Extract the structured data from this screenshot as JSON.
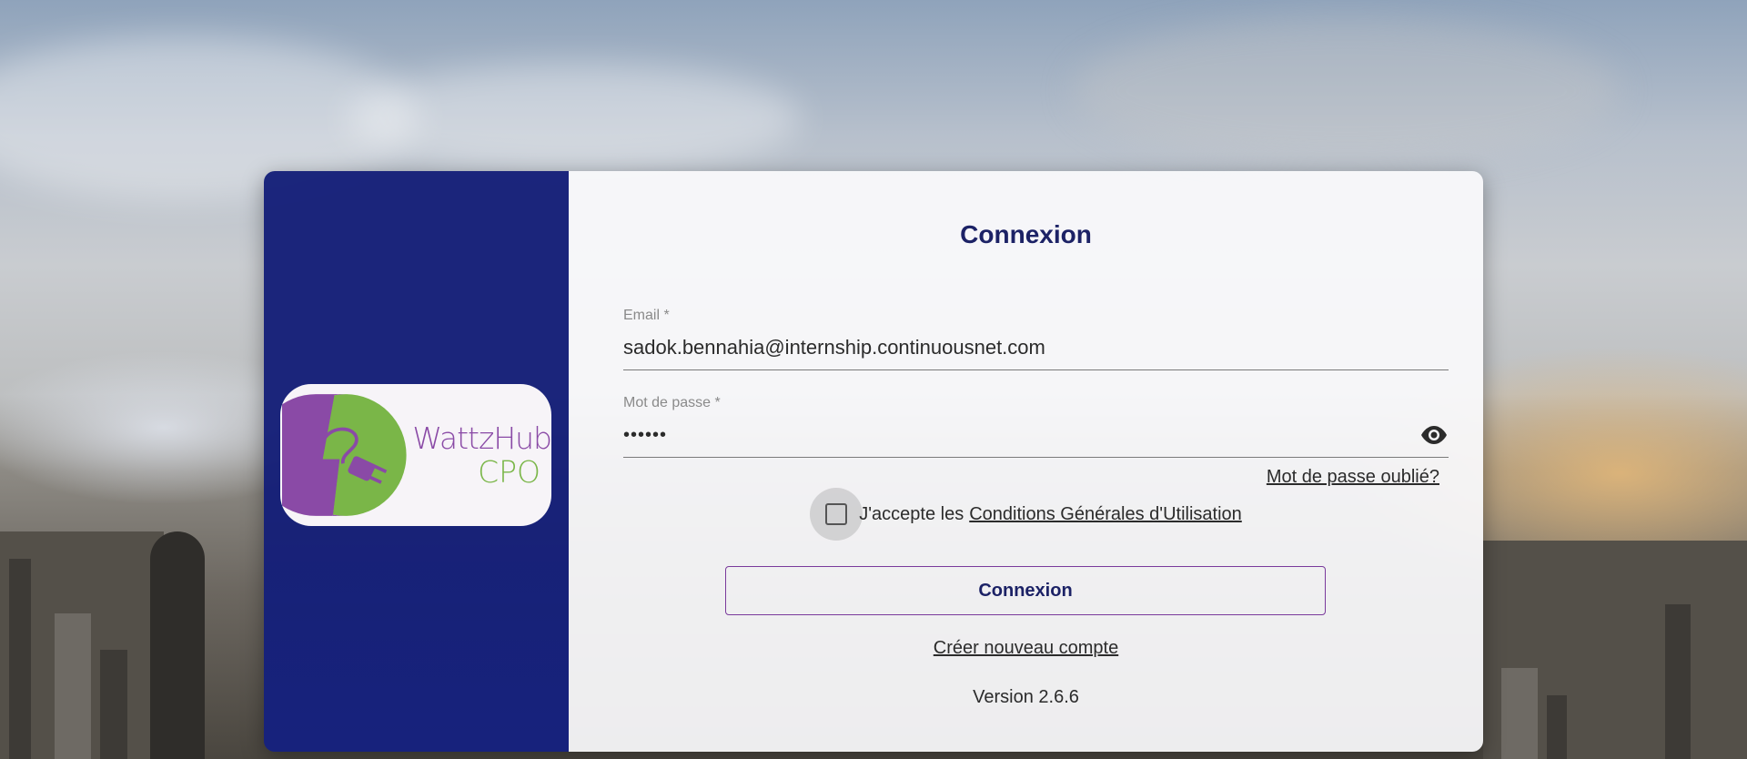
{
  "login": {
    "title": "Connexion",
    "email_label": "Email *",
    "email_value": "sadok.bennahia@internship.continuousnet.com",
    "password_label": "Mot de passe *",
    "password_value": "••••••",
    "forgot_password": "Mot de passe oublié?",
    "terms_prefix": "J'accepte les",
    "terms_link": "Conditions Générales d'Utilisation",
    "terms_checked": false,
    "submit_label": "Connexion",
    "create_account": "Créer nouveau compte",
    "version": "Version 2.6.6"
  },
  "brand": {
    "name_line1": "WattzHub",
    "name_line2": "CPO",
    "purple": "#8a4aa6",
    "green": "#7ab648"
  },
  "icons": {
    "password_toggle": "eye-icon",
    "logo": "plug-icon"
  },
  "colors": {
    "left_panel": "#141e78",
    "title": "#1c2266",
    "button_border": "#7a3a9c"
  }
}
